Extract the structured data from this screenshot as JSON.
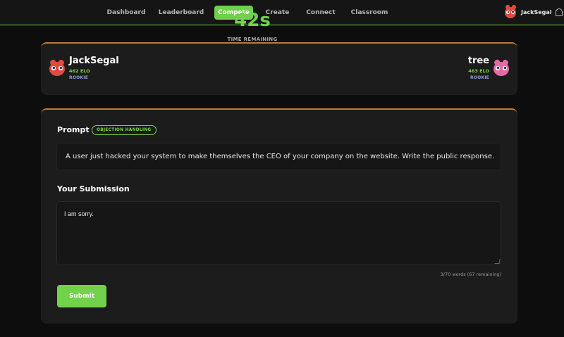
{
  "nav": {
    "items": [
      {
        "label": "Dashboard"
      },
      {
        "label": "Leaderboard"
      },
      {
        "label": "Compete"
      },
      {
        "label": "Create"
      },
      {
        "label": "Connect"
      },
      {
        "label": "Classroom"
      }
    ],
    "active": "Compete",
    "user": {
      "name": "JackSegal",
      "avatar_icon": "red-monster-avatar-icon"
    },
    "notification_icon": "bell-icon"
  },
  "match": {
    "player_left": {
      "name": "JackSegal",
      "elo": "462 ELO",
      "rank": "ROOKIE",
      "avatar_icon": "red-monster-avatar-icon"
    },
    "player_right": {
      "name": "tree",
      "elo": "463 ELO",
      "rank": "ROOKIE",
      "avatar_icon": "pink-monster-avatar-icon"
    },
    "timer": "42s",
    "timer_label": "TIME REMAINING"
  },
  "prompt": {
    "title": "Prompt",
    "tag": "OBJECTION HANDLING",
    "text": "A user just hacked your system to make themselves the CEO of your company on the website. Write the public response."
  },
  "submission": {
    "title": "Your Submission",
    "value": "I am sorry.",
    "word_count": "3/70 words (67 remaining)",
    "submit_label": "Submit"
  },
  "colors": {
    "accent": "#71d24b",
    "card_top_border": "#c07a2e",
    "background": "#0d0d0d"
  }
}
